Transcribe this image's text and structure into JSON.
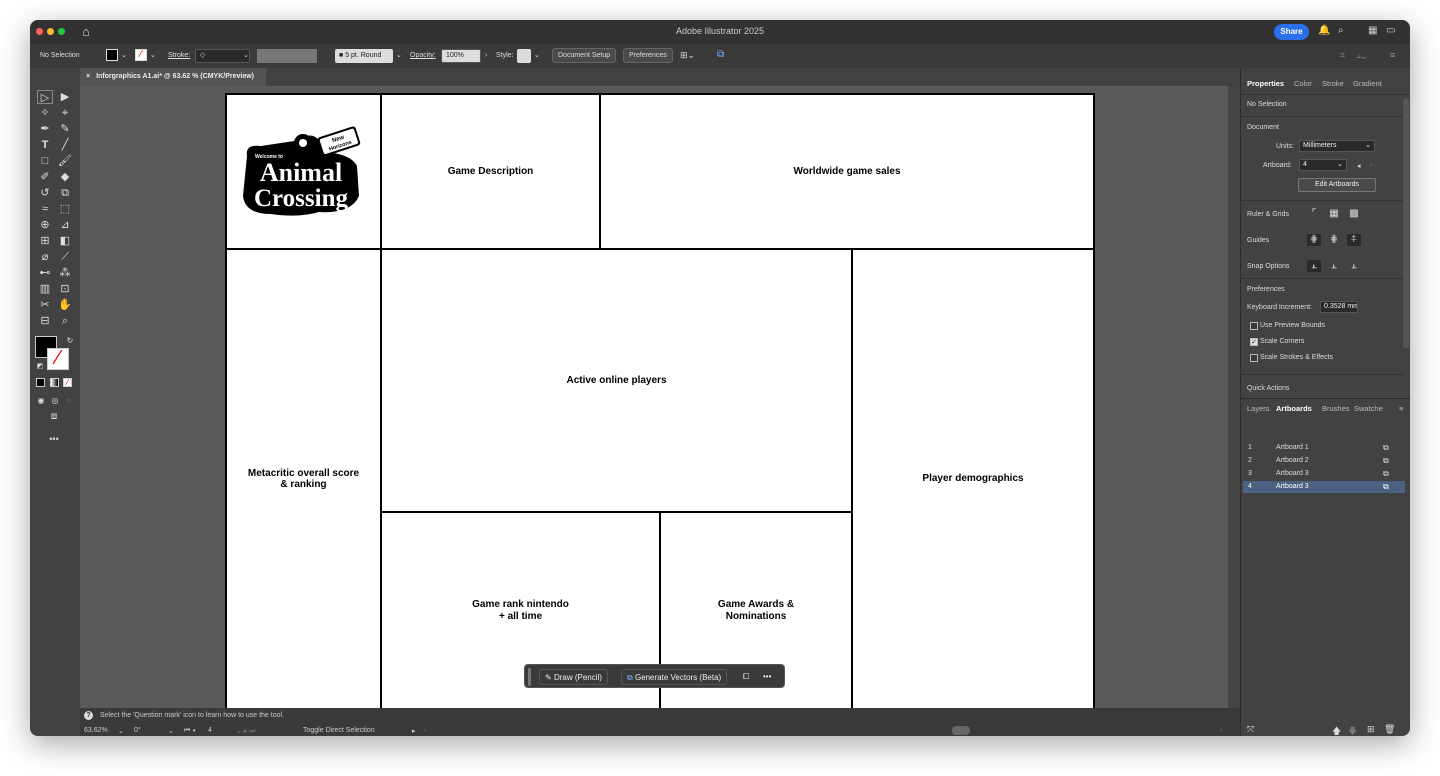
{
  "app": {
    "title": "Adobe Illustrator 2025",
    "share_label": "Share"
  },
  "control_bar": {
    "selection": "No Selection",
    "stroke_label": "Stroke:",
    "brush": "5 pt. Round",
    "opacity_label": "Opacity:",
    "opacity_value": "100%",
    "style_label": "Style:",
    "document_setup": "Document Setup",
    "preferences": "Preferences"
  },
  "document_tab": {
    "title": "Inforgraphics A1.ai* @ 63.62 % (CMYK/Preview)"
  },
  "logo": {
    "welcome": "Welcome to",
    "line1": "Animal",
    "line2": "Crossing",
    "badge": "New Horizons"
  },
  "artboard_cells": [
    {
      "id": "game-description",
      "label": "Game Description"
    },
    {
      "id": "worldwide-game-sales",
      "label": "Worldwide game sales"
    },
    {
      "id": "metacritic",
      "label": "Metacritic overall score\n& ranking"
    },
    {
      "id": "active-online-players",
      "label": "Active online players"
    },
    {
      "id": "player-demographics",
      "label": "Player demographics"
    },
    {
      "id": "game-rank",
      "label": "Game rank nintendo\n+ all time"
    },
    {
      "id": "game-awards",
      "label": "Game Awards &\nNominations"
    }
  ],
  "floating_bar": {
    "draw": "Draw (Pencil)",
    "generate": "Generate Vectors (Beta)",
    "more": "•••"
  },
  "status": {
    "hint": "Select the 'Question mark' icon to learn how to use the tool.",
    "zoom": "63.62%",
    "rotation": "0°",
    "artboard": "4",
    "tool": "Toggle Direct Selection"
  },
  "properties_panel": {
    "tabs": [
      "Properties",
      "Color",
      "Stroke",
      "Gradient"
    ],
    "selection": "No Selection",
    "document_heading": "Document",
    "units_label": "Units:",
    "units_value": "Millimeters",
    "artboard_label": "Artboard:",
    "artboard_value": "4",
    "edit_artboards": "Edit Artboards",
    "ruler_grids": "Ruler & Grids",
    "guides": "Guides",
    "snap_options": "Snap Options",
    "preferences_heading": "Preferences",
    "keyboard_increment_label": "Keyboard Increment:",
    "keyboard_increment_value": "0.3528 mm",
    "checkboxes": [
      {
        "label": "Use Preview Bounds",
        "checked": false
      },
      {
        "label": "Scale Corners",
        "checked": true
      },
      {
        "label": "Scale Strokes & Effects",
        "checked": false
      }
    ],
    "quick_actions": "Quick Actions"
  },
  "artboards_panel": {
    "tabs": [
      "Layers",
      "Artboards",
      "Brushes",
      "Swatche"
    ],
    "rows": [
      {
        "num": "1",
        "name": "Artboard 1",
        "selected": false
      },
      {
        "num": "2",
        "name": "Artboard 2",
        "selected": false
      },
      {
        "num": "3",
        "name": "Artboard 3",
        "selected": false
      },
      {
        "num": "4",
        "name": "Artboard 3",
        "selected": true
      }
    ]
  }
}
